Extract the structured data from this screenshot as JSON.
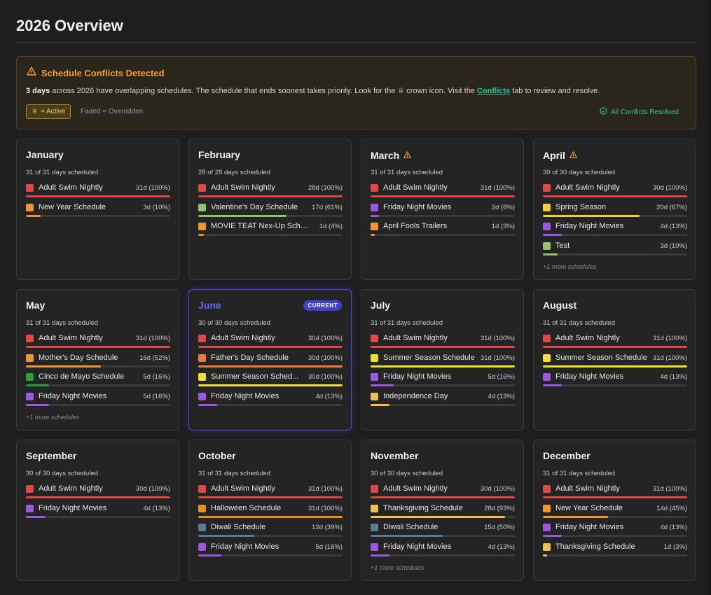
{
  "page": {
    "title": "2026 Overview"
  },
  "alert": {
    "title": "Schedule Conflicts Detected",
    "text_bold": "3 days",
    "text_part1": " across 2026 have overlapping schedules. The schedule that ends soonest takes priority. Look for the ",
    "crown_glyph": "♕",
    "text_part2": " crown icon. Visit the ",
    "link": "Conflicts",
    "text_part3": " tab to review and resolve.",
    "active_badge": "= Active",
    "faded_badge": "Faded = Overridden",
    "resolved": "All Conflicts Resolved",
    "colors": {
      "accent": "#f0a030",
      "link": "#2dc5a0",
      "resolved": "#35c48a"
    }
  },
  "months": [
    {
      "name": "January",
      "warning": false,
      "current": false,
      "days": "31 of 31 days scheduled",
      "schedules": [
        {
          "name": "Adult Swim Nightly",
          "count": "31d (100%)",
          "color": "#e04848",
          "pct": 100
        },
        {
          "name": "New Year Schedule",
          "count": "3d (10%)",
          "color": "#f0962e",
          "pct": 10
        }
      ],
      "more": ""
    },
    {
      "name": "February",
      "warning": false,
      "current": false,
      "days": "28 of 28 days scheduled",
      "schedules": [
        {
          "name": "Adult Swim Nightly",
          "count": "28d (100%)",
          "color": "#e04848",
          "pct": 100
        },
        {
          "name": "Valentine's Day Schedule",
          "count": "17d (61%)",
          "color": "#8ec46c",
          "pct": 61
        },
        {
          "name": "MOVIE TEAT Nex-Up Sche...",
          "count": "1d (4%)",
          "color": "#f0962e",
          "pct": 4
        }
      ],
      "more": ""
    },
    {
      "name": "March",
      "warning": true,
      "current": false,
      "days": "31 of 31 days scheduled",
      "schedules": [
        {
          "name": "Adult Swim Nightly",
          "count": "31d (100%)",
          "color": "#e04848",
          "pct": 100
        },
        {
          "name": "Friday Night Movies",
          "count": "2d (6%)",
          "color": "#9a58e0",
          "pct": 6
        },
        {
          "name": "April Fools Trailers",
          "count": "1d (3%)",
          "color": "#f0962e",
          "pct": 3
        }
      ],
      "more": ""
    },
    {
      "name": "April",
      "warning": true,
      "current": false,
      "days": "30 of 30 days scheduled",
      "schedules": [
        {
          "name": "Adult Swim Nightly",
          "count": "30d (100%)",
          "color": "#e04848",
          "pct": 100
        },
        {
          "name": "Spring Season",
          "count": "20d (67%)",
          "color": "#f0d030",
          "pct": 67
        },
        {
          "name": "Friday Night Movies",
          "count": "4d (13%)",
          "color": "#9a58e0",
          "pct": 13
        },
        {
          "name": "Test",
          "count": "3d (10%)",
          "color": "#8ec46c",
          "pct": 10
        }
      ],
      "more": "+1 more schedules"
    },
    {
      "name": "May",
      "warning": false,
      "current": false,
      "days": "31 of 31 days scheduled",
      "schedules": [
        {
          "name": "Adult Swim Nightly",
          "count": "31d (100%)",
          "color": "#e04848",
          "pct": 100
        },
        {
          "name": "Mother's Day Schedule",
          "count": "16d (52%)",
          "color": "#f0962e",
          "pct": 52
        },
        {
          "name": "Cinco de Mayo Schedule",
          "count": "5d (16%)",
          "color": "#2e9a3e",
          "pct": 16
        },
        {
          "name": "Friday Night Movies",
          "count": "5d (16%)",
          "color": "#9a58e0",
          "pct": 16
        }
      ],
      "more": "+1 more schedules"
    },
    {
      "name": "June",
      "warning": false,
      "current": true,
      "current_label": "CURRENT",
      "days": "30 of 30 days scheduled",
      "schedules": [
        {
          "name": "Adult Swim Nightly",
          "count": "30d (100%)",
          "color": "#e04848",
          "pct": 100
        },
        {
          "name": "Father's Day Schedule",
          "count": "30d (100%)",
          "color": "#f07a40",
          "pct": 100
        },
        {
          "name": "Summer Season Sched...",
          "count": "30d (100%)",
          "color": "#f0e030",
          "pct": 100
        },
        {
          "name": "Friday Night Movies",
          "count": "4d (13%)",
          "color": "#9a58e0",
          "pct": 13
        }
      ],
      "more": ""
    },
    {
      "name": "July",
      "warning": false,
      "current": false,
      "days": "31 of 31 days scheduled",
      "schedules": [
        {
          "name": "Adult Swim Nightly",
          "count": "31d (100%)",
          "color": "#e04848",
          "pct": 100
        },
        {
          "name": "Summer Season Schedule",
          "count": "31d (100%)",
          "color": "#f0e030",
          "pct": 100
        },
        {
          "name": "Friday Night Movies",
          "count": "5d (16%)",
          "color": "#9a58e0",
          "pct": 16
        },
        {
          "name": "Independence Day",
          "count": "4d (13%)",
          "color": "#f0c050",
          "pct": 13
        }
      ],
      "more": ""
    },
    {
      "name": "August",
      "warning": false,
      "current": false,
      "days": "31 of 31 days scheduled",
      "schedules": [
        {
          "name": "Adult Swim Nightly",
          "count": "31d (100%)",
          "color": "#e04848",
          "pct": 100
        },
        {
          "name": "Summer Season Schedule",
          "count": "31d (100%)",
          "color": "#f0e030",
          "pct": 100
        },
        {
          "name": "Friday Night Movies",
          "count": "4d (13%)",
          "color": "#9a58e0",
          "pct": 13
        }
      ],
      "more": ""
    },
    {
      "name": "September",
      "warning": false,
      "current": false,
      "days": "30 of 30 days scheduled",
      "schedules": [
        {
          "name": "Adult Swim Nightly",
          "count": "30d (100%)",
          "color": "#e04848",
          "pct": 100
        },
        {
          "name": "Friday Night Movies",
          "count": "4d (13%)",
          "color": "#9a58e0",
          "pct": 13
        }
      ],
      "more": ""
    },
    {
      "name": "October",
      "warning": false,
      "current": false,
      "days": "31 of 31 days scheduled",
      "schedules": [
        {
          "name": "Adult Swim Nightly",
          "count": "31d (100%)",
          "color": "#e04848",
          "pct": 100
        },
        {
          "name": "Halloween Schedule",
          "count": "31d (100%)",
          "color": "#e8901e",
          "pct": 100
        },
        {
          "name": "Diwali Schedule",
          "count": "12d (39%)",
          "color": "#5a7a9a",
          "pct": 39
        },
        {
          "name": "Friday Night Movies",
          "count": "5d (16%)",
          "color": "#9a58e0",
          "pct": 16
        }
      ],
      "more": ""
    },
    {
      "name": "November",
      "warning": false,
      "current": false,
      "days": "30 of 30 days scheduled",
      "schedules": [
        {
          "name": "Adult Swim Nightly",
          "count": "30d (100%)",
          "color": "#e04848",
          "pct": 100
        },
        {
          "name": "Thanksgiving Schedule",
          "count": "28d (93%)",
          "color": "#f0c050",
          "pct": 93
        },
        {
          "name": "Diwali Schedule",
          "count": "15d (50%)",
          "color": "#5a7a9a",
          "pct": 50
        },
        {
          "name": "Friday Night Movies",
          "count": "4d (13%)",
          "color": "#9a58e0",
          "pct": 13
        }
      ],
      "more": "+1 more schedules"
    },
    {
      "name": "December",
      "warning": false,
      "current": false,
      "days": "31 of 31 days scheduled",
      "schedules": [
        {
          "name": "Adult Swim Nightly",
          "count": "31d (100%)",
          "color": "#e04848",
          "pct": 100
        },
        {
          "name": "New Year Schedule",
          "count": "14d (45%)",
          "color": "#f0962e",
          "pct": 45
        },
        {
          "name": "Friday Night Movies",
          "count": "4d (13%)",
          "color": "#9a58e0",
          "pct": 13
        },
        {
          "name": "Thanksgiving Schedule",
          "count": "1d (3%)",
          "color": "#f0c050",
          "pct": 3
        }
      ],
      "more": ""
    }
  ]
}
